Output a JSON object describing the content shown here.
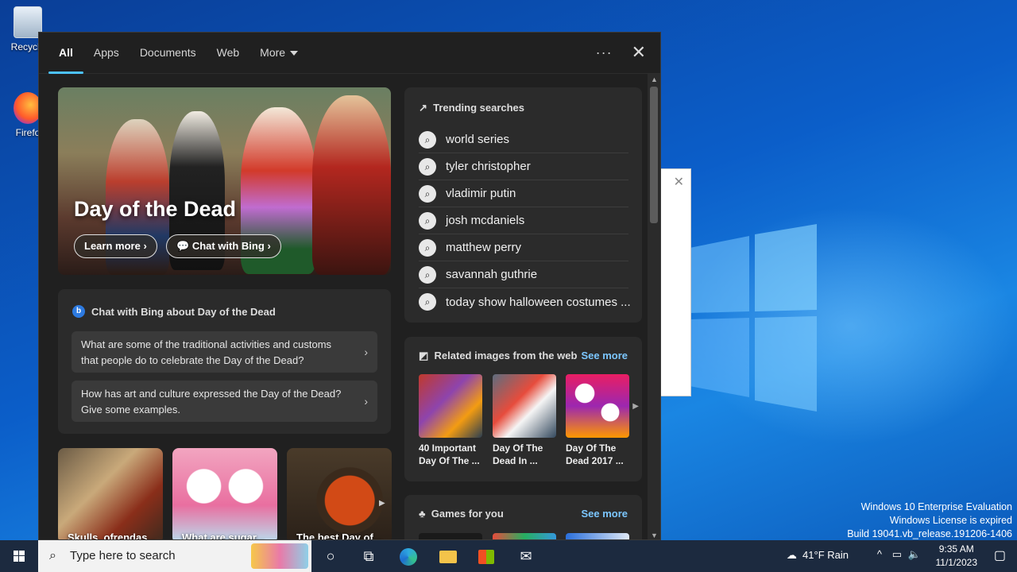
{
  "desktop": {
    "icons": [
      {
        "label": "Recycle",
        "icon": "recycle-bin-icon"
      },
      {
        "label": "Firefo",
        "icon": "firefox-icon"
      }
    ],
    "watermark": [
      "Windows 10 Enterprise Evaluation",
      "Windows License is expired",
      "Build 19041.vb_release.191206-1406"
    ]
  },
  "nav": {
    "tabs": [
      "All",
      "Apps",
      "Documents",
      "Web",
      "More"
    ],
    "active": "All",
    "more_icon": "ellipsis-icon",
    "close_icon": "close-icon"
  },
  "hero": {
    "title": "Day of the Dead",
    "learn_more": "Learn more",
    "chat_with_bing": "Chat with Bing"
  },
  "chat": {
    "header": "Chat with Bing about Day of the Dead",
    "questions": [
      "What are some of the traditional activities and customs that people do to celebrate the Day of the Dead?",
      "How has art and culture expressed the Day of the Dead? Give some examples."
    ]
  },
  "thumbs": [
    "Skulls, ofrendas...",
    "What are sugar...",
    "The best Day of..."
  ],
  "trending": {
    "header": "Trending searches",
    "items": [
      "world series",
      "tyler christopher",
      "vladimir putin",
      "josh mcdaniels",
      "matthew perry",
      "savannah guthrie",
      "today show halloween costumes ..."
    ]
  },
  "related": {
    "header": "Related images from the web",
    "see_more": "See more",
    "items": [
      "40 Important Day Of The ...",
      "Day Of The Dead In ...",
      "Day Of The Dead 2017 ..."
    ]
  },
  "games": {
    "header": "Games for you",
    "see_more": "See more"
  },
  "taskbar": {
    "search_placeholder": "Type here to search",
    "weather": "41°F  Rain",
    "time": "9:35 AM",
    "date": "11/1/2023"
  }
}
